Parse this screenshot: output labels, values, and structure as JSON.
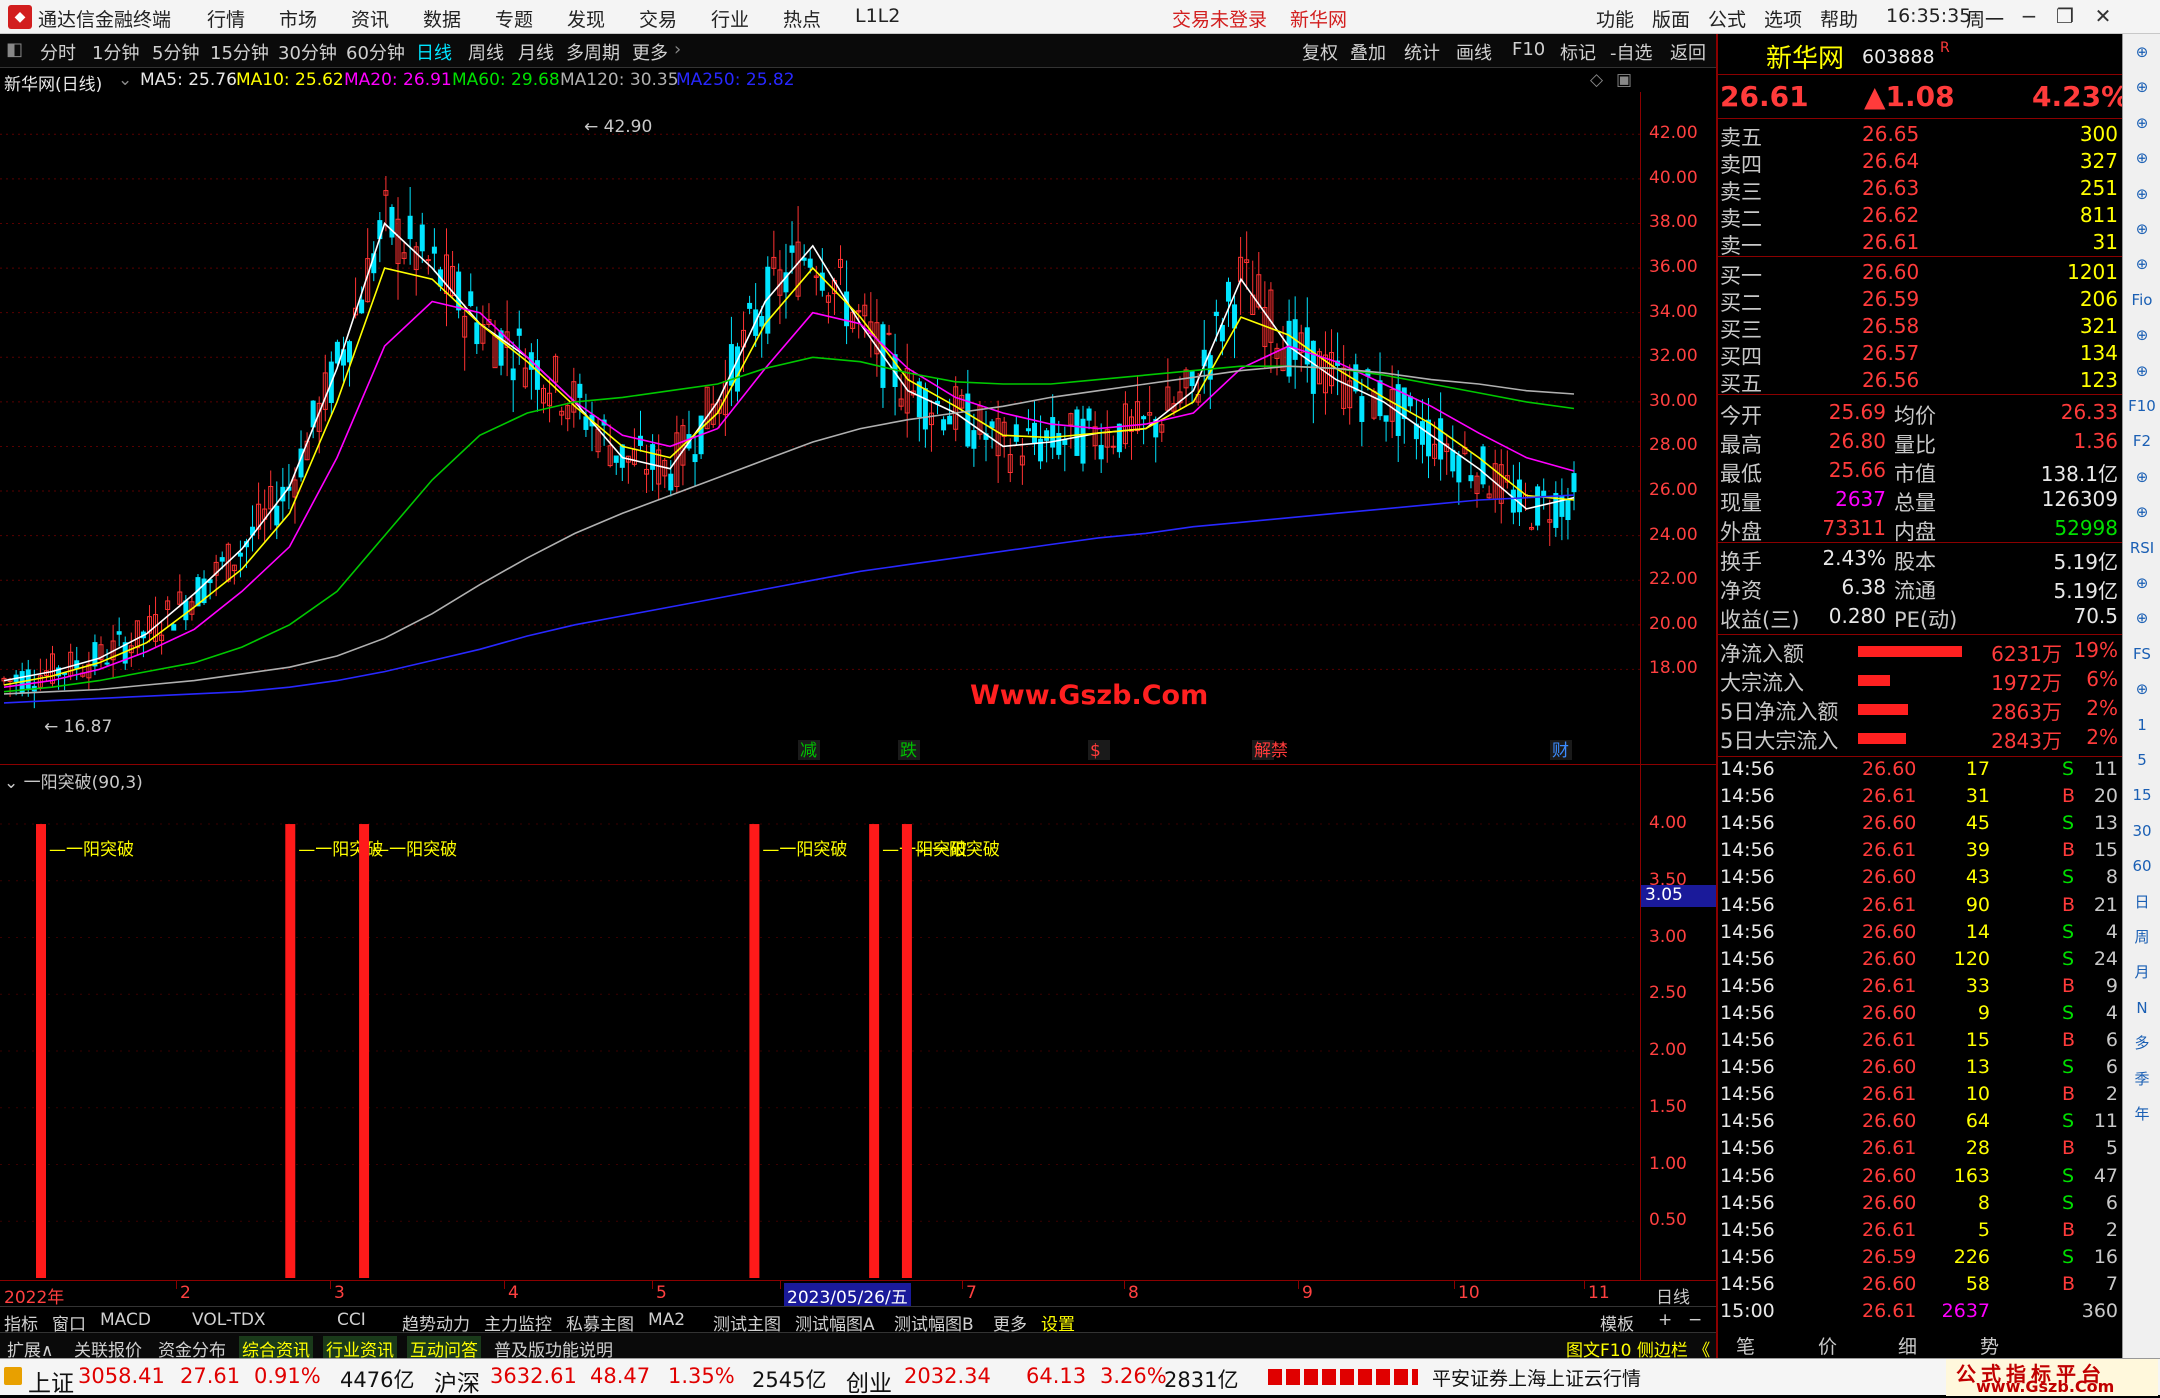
{
  "titlebar": {
    "app": "通达信金融终端",
    "menus": [
      "行情",
      "市场",
      "资讯",
      "数据",
      "专题",
      "发现",
      "交易",
      "行业",
      "热点",
      "L1L2"
    ],
    "login": "交易未登录",
    "stock_name": "新华网",
    "right_menus": [
      "功能",
      "版面",
      "公式",
      "选项",
      "帮助"
    ],
    "time": "16:35:35",
    "weekday": "周一"
  },
  "toolbar": {
    "periods": [
      "分时",
      "1分钟",
      "5分钟",
      "15分钟",
      "30分钟",
      "60分钟",
      "日线",
      "周线",
      "月线",
      "多周期",
      "更多"
    ],
    "active_period": "日线",
    "actions": [
      "复权",
      "叠加",
      "统计",
      "画线",
      "F10",
      "标记",
      "-自选",
      "返回"
    ]
  },
  "ma": {
    "name": "新华网(日线)",
    "ma5": "MA5: 25.76",
    "ma10": "MA10: 25.62",
    "ma20": "MA20: 26.91",
    "ma60": "MA60: 29.68",
    "ma120": "MA120: 30.35",
    "ma250": "MA250: 25.82"
  },
  "chart": {
    "high_label": "42.90",
    "low_label": "16.87",
    "watermark": "Www.Gszb.Com",
    "yticks": [
      "42.00",
      "40.00",
      "38.00",
      "36.00",
      "34.00",
      "32.00",
      "30.00",
      "28.00",
      "26.00",
      "24.00",
      "22.00",
      "20.00",
      "18.00"
    ],
    "markers": [
      {
        "t": "减",
        "c": "#00c000"
      },
      {
        "t": "跌",
        "c": "#00c000"
      },
      {
        "t": "$",
        "c": "#ff3b3b"
      },
      {
        "t": "解禁",
        "c": "#ff3b3b"
      },
      {
        "t": "财",
        "c": "#3c8cff"
      }
    ]
  },
  "chart_data": [
    {
      "type": "line",
      "title": "新华网(日线)",
      "y_range": [
        16,
        43
      ],
      "series": [
        {
          "name": "MA5",
          "color": "#ffffff",
          "values": [
            17.5,
            17.9,
            18.5,
            19.6,
            21.4,
            23.4,
            26.2,
            31.5,
            38.0,
            36.0,
            33.5,
            32.0,
            30.0,
            27.5,
            27.0,
            30.0,
            34.5,
            37.0,
            33.5,
            30.5,
            29.5,
            28.0,
            28.2,
            28.6,
            28.8,
            30.5,
            35.5,
            32.5,
            31.0,
            30.0,
            28.5,
            27.0,
            25.2,
            25.7
          ]
        },
        {
          "name": "MA10",
          "color": "#ffff00",
          "values": [
            17.3,
            17.7,
            18.3,
            19.2,
            20.8,
            22.5,
            25.0,
            30.0,
            36.0,
            35.5,
            33.5,
            31.8,
            29.8,
            28.0,
            27.5,
            29.5,
            33.5,
            36.0,
            33.8,
            31.0,
            29.8,
            28.5,
            28.4,
            28.6,
            28.8,
            30.0,
            33.8,
            33.0,
            31.5,
            30.2,
            29.0,
            27.5,
            25.8,
            25.6
          ]
        },
        {
          "name": "MA20",
          "color": "#ff00ff",
          "values": [
            17.2,
            17.5,
            18.0,
            18.8,
            19.8,
            21.5,
            23.5,
            27.5,
            32.5,
            34.5,
            34.0,
            32.0,
            30.0,
            28.5,
            28.0,
            28.8,
            31.5,
            34.0,
            33.5,
            31.5,
            30.2,
            29.5,
            29.0,
            28.8,
            29.0,
            29.5,
            31.5,
            32.5,
            31.8,
            30.8,
            29.8,
            28.6,
            27.5,
            26.9
          ]
        },
        {
          "name": "MA60",
          "color": "#00c800",
          "values": [
            17.0,
            17.2,
            17.5,
            17.9,
            18.3,
            19.0,
            20.0,
            21.5,
            24.0,
            26.5,
            28.5,
            29.5,
            30.0,
            30.2,
            30.5,
            30.8,
            31.5,
            32.0,
            31.8,
            31.3,
            30.9,
            30.8,
            30.8,
            31.0,
            31.2,
            31.4,
            31.6,
            31.6,
            31.5,
            31.2,
            30.8,
            30.4,
            30.0,
            29.7
          ]
        },
        {
          "name": "MA120",
          "color": "#b0b0b0",
          "values": [
            16.9,
            17.0,
            17.1,
            17.3,
            17.5,
            17.8,
            18.1,
            18.6,
            19.4,
            20.5,
            21.8,
            23.0,
            24.1,
            25.0,
            25.8,
            26.6,
            27.4,
            28.2,
            28.8,
            29.2,
            29.5,
            29.8,
            30.2,
            30.5,
            30.8,
            31.1,
            31.4,
            31.6,
            31.5,
            31.3,
            31.0,
            30.8,
            30.5,
            30.35
          ]
        },
        {
          "name": "MA250",
          "color": "#2828ff",
          "values": [
            16.5,
            16.6,
            16.7,
            16.8,
            16.9,
            17.0,
            17.2,
            17.5,
            17.9,
            18.4,
            18.9,
            19.5,
            20.0,
            20.4,
            20.8,
            21.2,
            21.6,
            22.0,
            22.4,
            22.7,
            23.0,
            23.3,
            23.6,
            23.9,
            24.1,
            24.4,
            24.6,
            24.8,
            25.0,
            25.2,
            25.4,
            25.6,
            25.7,
            25.82
          ]
        }
      ]
    },
    {
      "type": "bar",
      "title": "一阳突破(90,3)",
      "y_range": [
        0,
        4.3
      ],
      "bar_label": "一阳突破",
      "bar_x_fraction": [
        0.025,
        0.177,
        0.222,
        0.46,
        0.533,
        0.553
      ],
      "bar_values": [
        4.0,
        4.0,
        4.0,
        4.0,
        4.0,
        4.0
      ]
    }
  ],
  "indicator": {
    "title": "一阳突破(90,3)",
    "label": "一阳突破",
    "yticks": [
      "4.00",
      "3.50",
      "3.00",
      "2.50",
      "2.00",
      "1.50",
      "1.00",
      "0.50"
    ],
    "current": "3.05"
  },
  "xaxis": {
    "labels": [
      "2022年",
      "2",
      "3",
      "4",
      "5",
      "2023/05/26/五",
      "7",
      "8",
      "9",
      "10",
      "11"
    ],
    "right": "日线"
  },
  "tabs": [
    "指标",
    "窗口",
    "MACD",
    "VOL-TDX",
    "CCI",
    "趋势动力",
    "主力监控",
    "私募主图",
    "MA2",
    "测试主图",
    "测试幅图A",
    "测试幅图B",
    "更多",
    "设置"
  ],
  "tabs_right": [
    "模板",
    "+",
    "−"
  ],
  "tabs2": [
    "扩展∧",
    "关联报价",
    "资金分布",
    "综合资讯",
    "行业资讯",
    "互动问答",
    "普及版功能说明"
  ],
  "tabs2_right": "图文F10 侧边栏 《",
  "quote": {
    "name": "新华网",
    "code": "603888",
    "suffix": "R",
    "price": "26.61",
    "change": "▲1.08",
    "pct": "4.23%",
    "asks": [
      [
        "卖五",
        "26.65",
        "300"
      ],
      [
        "卖四",
        "26.64",
        "327"
      ],
      [
        "卖三",
        "26.63",
        "251"
      ],
      [
        "卖二",
        "26.62",
        "811"
      ],
      [
        "卖一",
        "26.61",
        "31"
      ]
    ],
    "bids": [
      [
        "买一",
        "26.60",
        "1201"
      ],
      [
        "买二",
        "26.59",
        "206"
      ],
      [
        "买三",
        "26.58",
        "321"
      ],
      [
        "买四",
        "26.57",
        "134"
      ],
      [
        "买五",
        "26.56",
        "123"
      ]
    ],
    "stats": [
      [
        "今开",
        "25.69",
        "均价",
        "26.33"
      ],
      [
        "最高",
        "26.80",
        "量比",
        "1.36"
      ],
      [
        "最低",
        "25.66",
        "市值",
        "138.1亿"
      ],
      [
        "现量",
        "2637",
        "总量",
        "126309"
      ],
      [
        "外盘",
        "73311",
        "内盘",
        "52998"
      ]
    ],
    "stats2": [
      [
        "换手",
        "2.43%",
        "股本",
        "5.19亿"
      ],
      [
        "净资",
        "6.38",
        "流通",
        "5.19亿"
      ],
      [
        "收益(三)",
        "0.280",
        "PE(动)",
        "70.5"
      ]
    ],
    "flows": [
      [
        "净流入额",
        "6231万",
        "19%"
      ],
      [
        "大宗流入",
        "1972万",
        "6%"
      ],
      [
        "5日净流入额",
        "2863万",
        "2%"
      ],
      [
        "5日大宗流入",
        "2843万",
        "2%"
      ]
    ],
    "ticks": [
      [
        "14:56",
        "26.60",
        "17",
        "S",
        "11"
      ],
      [
        "14:56",
        "26.61",
        "31",
        "B",
        "20"
      ],
      [
        "14:56",
        "26.60",
        "45",
        "S",
        "13"
      ],
      [
        "14:56",
        "26.61",
        "39",
        "B",
        "15"
      ],
      [
        "14:56",
        "26.60",
        "43",
        "S",
        "8"
      ],
      [
        "14:56",
        "26.61",
        "90",
        "B",
        "21"
      ],
      [
        "14:56",
        "26.60",
        "14",
        "S",
        "4"
      ],
      [
        "14:56",
        "26.60",
        "120",
        "S",
        "24"
      ],
      [
        "14:56",
        "26.61",
        "33",
        "B",
        "9"
      ],
      [
        "14:56",
        "26.60",
        "9",
        "S",
        "4"
      ],
      [
        "14:56",
        "26.61",
        "15",
        "B",
        "6"
      ],
      [
        "14:56",
        "26.60",
        "13",
        "S",
        "6"
      ],
      [
        "14:56",
        "26.61",
        "10",
        "B",
        "2"
      ],
      [
        "14:56",
        "26.60",
        "64",
        "S",
        "11"
      ],
      [
        "14:56",
        "26.61",
        "28",
        "B",
        "5"
      ],
      [
        "14:56",
        "26.60",
        "163",
        "S",
        "47"
      ],
      [
        "14:56",
        "26.60",
        "8",
        "S",
        "6"
      ],
      [
        "14:56",
        "26.61",
        "5",
        "B",
        "2"
      ],
      [
        "14:56",
        "26.59",
        "226",
        "S",
        "16"
      ],
      [
        "14:56",
        "26.60",
        "58",
        "B",
        "7"
      ],
      [
        "15:00",
        "26.61",
        "2637",
        "",
        "360"
      ]
    ],
    "bottom_tabs": [
      "笔",
      "价",
      "细",
      "势"
    ]
  },
  "sidebar": [
    "⊕",
    "⊕",
    "⊕",
    "⊕",
    "⊕",
    "⊕",
    "⊕",
    "Fio",
    "⊕",
    "⊕",
    "F10",
    "F2",
    "⊕",
    "⊕",
    "RSI",
    "⊕",
    "⊕",
    "FS",
    "⊕",
    "1",
    "5",
    "15",
    "30",
    "60",
    "日",
    "周",
    "月",
    "N",
    "多",
    "季",
    "年"
  ],
  "statusbar": {
    "sh_label": "上证",
    "sh_val": "3058.41",
    "sh_chg": "27.61",
    "sh_pct": "0.91%",
    "sh_amt": "4476亿",
    "hs_label": "沪深",
    "hs_val": "3632.61",
    "hs_chg": "48.47",
    "hs_pct": "1.35%",
    "hs_amt": "2545亿",
    "cy_label": "创业",
    "cy_val": "2032.34",
    "cy_chg": "64.13",
    "cy_pct": "3.26%",
    "cy_amt": "2831亿",
    "broker": "平安证券上海上证云行情",
    "brand": "公式指标平台",
    "brand_url": "www.Gszb.Com"
  }
}
